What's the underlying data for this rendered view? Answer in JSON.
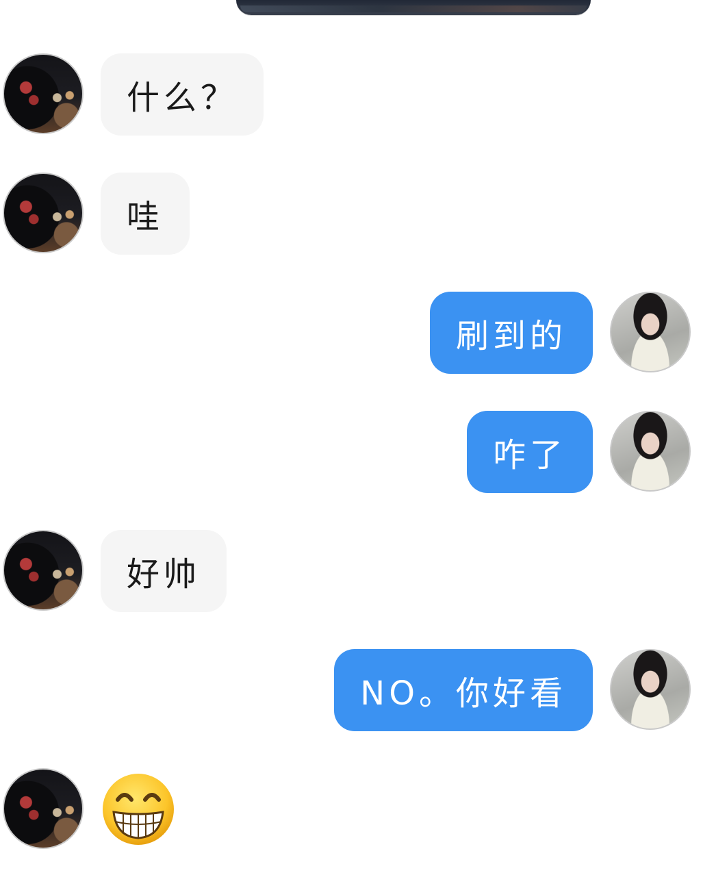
{
  "chat": {
    "messages": [
      {
        "side": "in",
        "text": "什么？"
      },
      {
        "side": "in",
        "text": "哇"
      },
      {
        "side": "out",
        "text": "刷到的"
      },
      {
        "side": "out",
        "text": "咋了"
      },
      {
        "side": "in",
        "text": "好帅"
      },
      {
        "side": "out",
        "text": "NO。你好看"
      },
      {
        "side": "in",
        "emoji": "grinning-face-icon"
      }
    ]
  },
  "colors": {
    "incoming_bubble": "#f5f5f5",
    "outgoing_bubble": "#3b92f2",
    "incoming_text": "#1a1a1a",
    "outgoing_text": "#ffffff"
  }
}
